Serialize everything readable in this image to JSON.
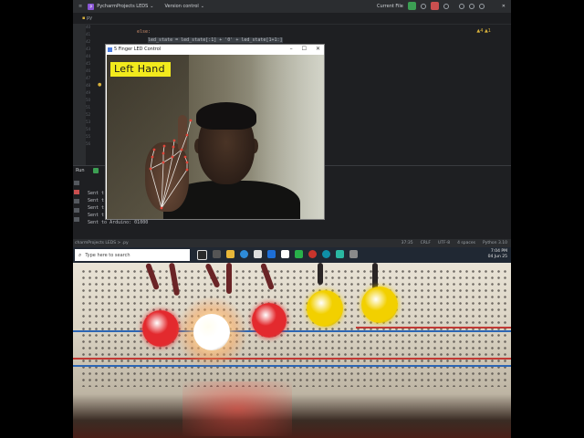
{
  "ide": {
    "project_name": "PycharmProjects LEDS",
    "vcs_label": "Version control",
    "run_config": "Current File",
    "tab_name": "py"
  },
  "editor": {
    "line_numbers": [
      "40",
      "41",
      "42",
      "43",
      "44",
      "45",
      "46",
      "47",
      "48",
      "49",
      "50",
      "51",
      "52",
      "53",
      "54",
      "55",
      "56"
    ],
    "lines": [
      "else:",
      "led_state = led_state[:1] + '0' + led_state[1+1:]"
    ],
    "warnings": "▲4  ▲1"
  },
  "run_panel": {
    "label": "Run",
    "console_lines": [
      "Sent t",
      "Sent t",
      "Sent t",
      "Sent t",
      "Sent to Arduino: 01000"
    ]
  },
  "status_bar": {
    "path": "charmProjects  LEDS  >  .py",
    "position": "37:35",
    "line_sep": "CRLF",
    "encoding": "UTF-8",
    "indent": "4 spaces",
    "interpreter": "Python 3.10"
  },
  "taskbar": {
    "search_placeholder": "Type here to search",
    "time": "7:04 PM",
    "date": "04 Jun 25"
  },
  "cam_window": {
    "title": "5 Finger LED Control",
    "hand_label": "Left Hand"
  },
  "leds": [
    {
      "color": "#e32a2e",
      "state": "off"
    },
    {
      "color": "#ffffff",
      "state": "on"
    },
    {
      "color": "#e32a2e",
      "state": "off"
    },
    {
      "color": "#f2d000",
      "state": "off"
    },
    {
      "color": "#f2d000",
      "state": "off"
    }
  ]
}
